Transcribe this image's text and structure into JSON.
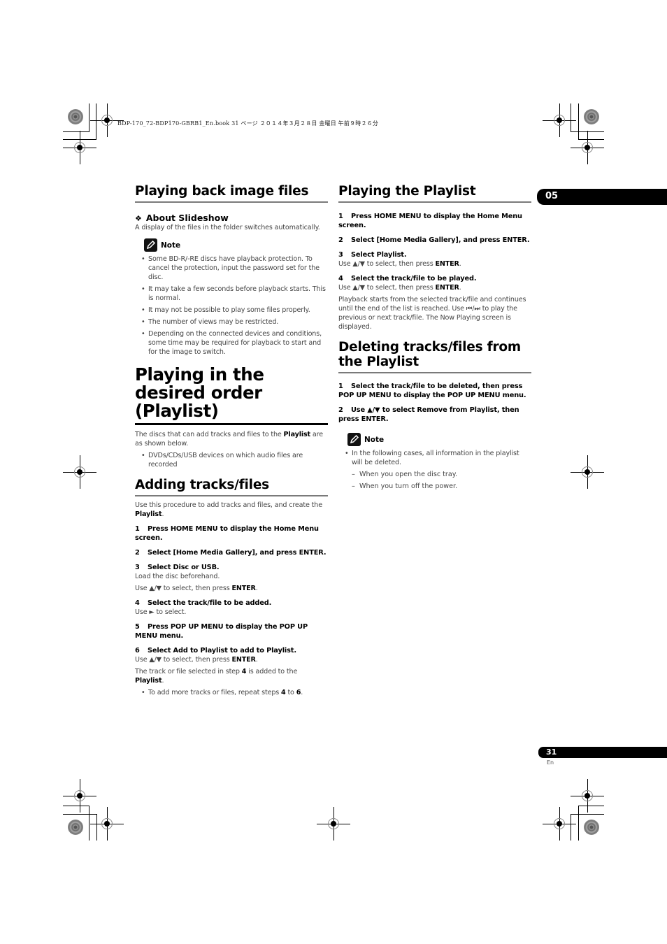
{
  "header_stamp": "BDP-170_72-BDP170-GBRB1_En.book  31 ページ  ２０１４年３月２８日  金曜日  午前９時２６分",
  "chapter_tab": "05",
  "footer": {
    "page_number": "31",
    "language": "En"
  },
  "left_column": {
    "image_files": {
      "title": "Playing back image files",
      "about_slideshow": {
        "symbol": "❖",
        "title": "About Slideshow",
        "text": "A display of the files in the folder switches automatically."
      },
      "note": {
        "label": "Note",
        "items": [
          "Some BD-R/-RE discs have playback protection. To cancel the protection, input the password set for the disc.",
          "It may take a few seconds before playback starts. This is normal.",
          "It may not be possible to play some files properly.",
          "The number of views may be restricted.",
          "Depending on the connected devices and conditions, some time may be required for playback to start and for the image to switch."
        ]
      }
    },
    "playlist_intro": {
      "title": "Playing in the desired order (Playlist)",
      "text_before": "The discs that can add tracks and files to the ",
      "text_bold": "Playlist",
      "text_after": " are as shown below.",
      "items": [
        "DVDs/CDs/USB devices on which audio files are recorded"
      ]
    },
    "adding": {
      "title": "Adding tracks/files",
      "intro_before": "Use this procedure to add tracks and files, and create the ",
      "intro_bold": "Playlist",
      "intro_after": ".",
      "steps": [
        {
          "num": "1",
          "text": "Press HOME MENU to display the Home Menu screen."
        },
        {
          "num": "2",
          "text": "Select [Home Media Gallery], and press ENTER."
        },
        {
          "num": "3",
          "text": "Select Disc or USB.",
          "sub1": "Load the disc beforehand.",
          "sub2_before": "Use ▲/▼ to select, then press ",
          "sub2_bold": "ENTER",
          "sub2_after": "."
        },
        {
          "num": "4",
          "text": "Select the track/file to be added.",
          "sub1": "Use ► to select."
        },
        {
          "num": "5",
          "text": "Press POP UP MENU to display the POP UP MENU menu."
        },
        {
          "num": "6",
          "text": "Select Add to Playlist to add to Playlist.",
          "sub2_before": "Use ▲/▼ to select, then press ",
          "sub2_bold": "ENTER",
          "sub2_after": "."
        }
      ],
      "result": {
        "a": "The track or file selected in step ",
        "b": "4",
        "c": " is added to the ",
        "d": "Playlist",
        "e": "."
      },
      "tip": {
        "a": "To add more tracks or files, repeat steps ",
        "b": "4",
        "c": " to ",
        "d": "6",
        "e": "."
      }
    }
  },
  "right_column": {
    "playing": {
      "title": "Playing the Playlist",
      "steps": [
        {
          "num": "1",
          "text": "Press HOME MENU to display the Home Menu screen."
        },
        {
          "num": "2",
          "text": "Select [Home Media Gallery], and press ENTER."
        },
        {
          "num": "3",
          "text": "Select Playlist.",
          "sub_before": "Use ▲/▼ to select, then press ",
          "sub_bold": "ENTER",
          "sub_after": "."
        },
        {
          "num": "4",
          "text": "Select the track/file to be played.",
          "sub_before": "Use ▲/▼ to select, then press ",
          "sub_bold": "ENTER",
          "sub_after": "."
        }
      ],
      "description": "Playback starts from the selected track/file and continues until the end of the list is reached. Use ⏮/⏭ to play the previous or next track/file. The Now Playing screen is displayed."
    },
    "deleting": {
      "title": "Deleting tracks/files from the Playlist",
      "steps": [
        {
          "num": "1",
          "text": "Select the track/file to be deleted, then press POP UP MENU to display the POP UP MENU menu."
        },
        {
          "num": "2",
          "text": "Use ▲/▼ to select Remove from Playlist, then press ENTER."
        }
      ],
      "note": {
        "label": "Note",
        "item": "In the following cases, all information in the playlist will be deleted.",
        "sub_items": [
          "When you open the disc tray.",
          "When you turn off the power."
        ]
      }
    }
  }
}
